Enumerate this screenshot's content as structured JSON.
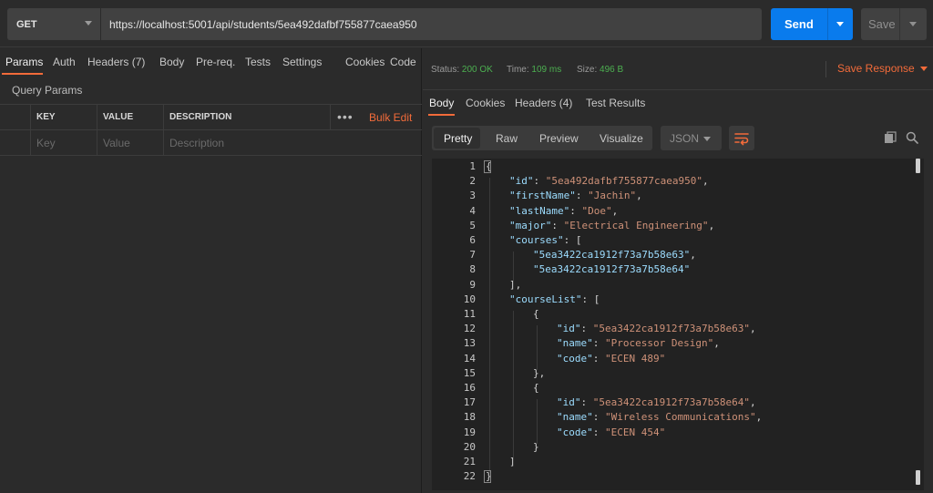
{
  "request": {
    "method": "GET",
    "url": "https://localhost:5001/api/students/5ea492dafbf755877caea950",
    "send_label": "Send",
    "save_label": "Save"
  },
  "request_tabs": {
    "params": "Params",
    "auth": "Auth",
    "headers": "Headers",
    "headers_count": "(7)",
    "body": "Body",
    "prereq": "Pre-req.",
    "tests": "Tests",
    "settings": "Settings",
    "cookies": "Cookies",
    "code": "Code"
  },
  "query_params": {
    "title": "Query Params",
    "columns": [
      "KEY",
      "VALUE",
      "DESCRIPTION"
    ],
    "placeholders": [
      "Key",
      "Value",
      "Description"
    ],
    "more_label": "•••",
    "bulk_edit": "Bulk Edit"
  },
  "response": {
    "status_label": "Status:",
    "status_value": "200 OK",
    "time_label": "Time:",
    "time_value": "109 ms",
    "size_label": "Size:",
    "size_value": "496 B",
    "save_response": "Save Response"
  },
  "response_tabs": {
    "body": "Body",
    "cookies": "Cookies",
    "headers": "Headers",
    "headers_count": "(4)",
    "test_results": "Test Results"
  },
  "view_modes": [
    "Pretty",
    "Raw",
    "Preview",
    "Visualize"
  ],
  "format": "JSON",
  "icons": {
    "wrap": "wrap-lines-icon",
    "copy": "copy-icon",
    "search": "search-icon"
  },
  "colors": {
    "accent": "#f26b3a",
    "send": "#097bed",
    "success": "#4caf50"
  },
  "code_lines": [
    {
      "n": "1",
      "indent": 0,
      "parts": [
        [
          "p",
          "{"
        ]
      ]
    },
    {
      "n": "2",
      "indent": 1,
      "parts": [
        [
          "k",
          "\"id\""
        ],
        [
          "p",
          ": "
        ],
        [
          "st",
          "\"5ea492dafbf755877caea950\""
        ],
        [
          "p",
          ","
        ]
      ]
    },
    {
      "n": "3",
      "indent": 1,
      "parts": [
        [
          "k",
          "\"firstName\""
        ],
        [
          "p",
          ": "
        ],
        [
          "st",
          "\"Jachin\""
        ],
        [
          "p",
          ","
        ]
      ]
    },
    {
      "n": "4",
      "indent": 1,
      "parts": [
        [
          "k",
          "\"lastName\""
        ],
        [
          "p",
          ": "
        ],
        [
          "st",
          "\"Doe\""
        ],
        [
          "p",
          ","
        ]
      ]
    },
    {
      "n": "5",
      "indent": 1,
      "parts": [
        [
          "k",
          "\"major\""
        ],
        [
          "p",
          ": "
        ],
        [
          "st",
          "\"Electrical Engineering\""
        ],
        [
          "p",
          ","
        ]
      ]
    },
    {
      "n": "6",
      "indent": 1,
      "parts": [
        [
          "k",
          "\"courses\""
        ],
        [
          "p",
          ": ["
        ]
      ]
    },
    {
      "n": "7",
      "indent": 2,
      "parts": [
        [
          "k",
          "\"5ea3422ca1912f73a7b58e63\""
        ],
        [
          "p",
          ","
        ]
      ]
    },
    {
      "n": "8",
      "indent": 2,
      "parts": [
        [
          "k",
          "\"5ea3422ca1912f73a7b58e64\""
        ]
      ]
    },
    {
      "n": "9",
      "indent": 1,
      "parts": [
        [
          "p",
          "],"
        ]
      ]
    },
    {
      "n": "10",
      "indent": 1,
      "parts": [
        [
          "k",
          "\"courseList\""
        ],
        [
          "p",
          ": ["
        ]
      ]
    },
    {
      "n": "11",
      "indent": 2,
      "parts": [
        [
          "p",
          "{"
        ]
      ]
    },
    {
      "n": "12",
      "indent": 3,
      "parts": [
        [
          "k",
          "\"id\""
        ],
        [
          "p",
          ": "
        ],
        [
          "st",
          "\"5ea3422ca1912f73a7b58e63\""
        ],
        [
          "p",
          ","
        ]
      ]
    },
    {
      "n": "13",
      "indent": 3,
      "parts": [
        [
          "k",
          "\"name\""
        ],
        [
          "p",
          ": "
        ],
        [
          "st",
          "\"Processor Design\""
        ],
        [
          "p",
          ","
        ]
      ]
    },
    {
      "n": "14",
      "indent": 3,
      "parts": [
        [
          "k",
          "\"code\""
        ],
        [
          "p",
          ": "
        ],
        [
          "st",
          "\"ECEN 489\""
        ]
      ]
    },
    {
      "n": "15",
      "indent": 2,
      "parts": [
        [
          "p",
          "},"
        ]
      ]
    },
    {
      "n": "16",
      "indent": 2,
      "parts": [
        [
          "p",
          "{"
        ]
      ]
    },
    {
      "n": "17",
      "indent": 3,
      "parts": [
        [
          "k",
          "\"id\""
        ],
        [
          "p",
          ": "
        ],
        [
          "st",
          "\"5ea3422ca1912f73a7b58e64\""
        ],
        [
          "p",
          ","
        ]
      ]
    },
    {
      "n": "18",
      "indent": 3,
      "parts": [
        [
          "k",
          "\"name\""
        ],
        [
          "p",
          ": "
        ],
        [
          "st",
          "\"Wireless Communications\""
        ],
        [
          "p",
          ","
        ]
      ]
    },
    {
      "n": "19",
      "indent": 3,
      "parts": [
        [
          "k",
          "\"code\""
        ],
        [
          "p",
          ": "
        ],
        [
          "st",
          "\"ECEN 454\""
        ]
      ]
    },
    {
      "n": "20",
      "indent": 2,
      "parts": [
        [
          "p",
          "}"
        ]
      ]
    },
    {
      "n": "21",
      "indent": 1,
      "parts": [
        [
          "p",
          "]"
        ]
      ]
    },
    {
      "n": "22",
      "indent": 0,
      "parts": [
        [
          "p",
          "}"
        ]
      ]
    }
  ]
}
